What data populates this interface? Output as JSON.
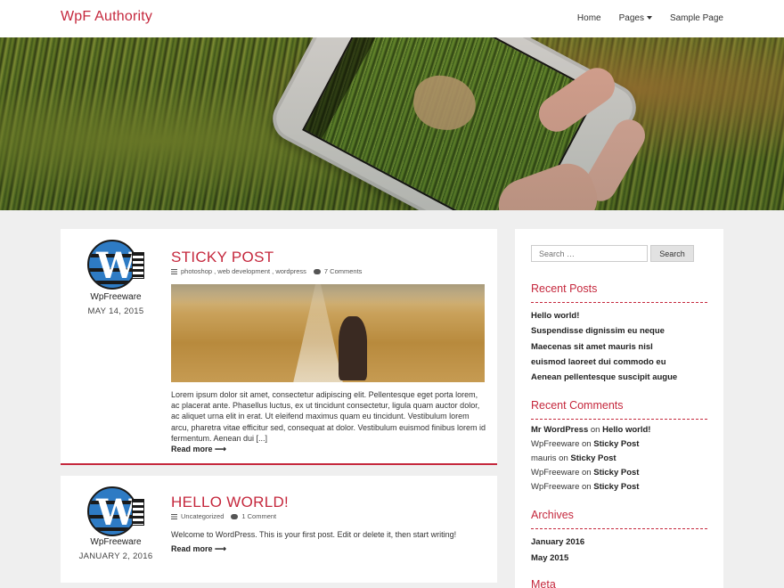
{
  "site": {
    "title": "WpF Authority"
  },
  "nav": {
    "home": "Home",
    "pages": "Pages",
    "sample": "Sample Page"
  },
  "posts": [
    {
      "author": "WpFreeware",
      "date": "MAY 14, 2015",
      "title": "STICKY POST",
      "categories": "photoshop , web development , wordpress",
      "comments": "7 Comments",
      "excerpt": "Lorem ipsum dolor sit amet, consectetur adipiscing elit. Pellentesque eget porta lorem, ac placerat ante. Phasellus luctus, ex ut tincidunt consectetur, ligula quam auctor dolor, ac aliquet urna elit in erat. Ut eleifend maximus quam eu tincidunt. Vestibulum lorem arcu, pharetra vitae efficitur sed, consequat at dolor. Vestibulum euismod finibus lorem id fermentum. Aenean dui [...]",
      "readmore": "Read more ⟶"
    },
    {
      "author": "WpFreeware",
      "date": "JANUARY 2, 2016",
      "title": "HELLO WORLD!",
      "categories": "Uncategorized",
      "comments": "1 Comment",
      "excerpt": "Welcome to WordPress. This is your first post. Edit or delete it, then start writing!",
      "readmore": "Read more ⟶"
    }
  ],
  "sidebar": {
    "search": {
      "placeholder": "Search …",
      "button": "Search"
    },
    "recent_posts": {
      "title": "Recent Posts",
      "items": [
        "Hello world!",
        "Suspendisse dignissim eu neque",
        "Maecenas sit amet mauris nisl",
        "euismod laoreet dui commodo eu",
        "Aenean pellentesque suscipit augue"
      ]
    },
    "recent_comments": {
      "title": "Recent Comments",
      "on": "on",
      "items": [
        {
          "author": "Mr WordPress",
          "post": "Hello world!"
        },
        {
          "author": "WpFreeware",
          "post": "Sticky Post"
        },
        {
          "author": "mauris",
          "post": "Sticky Post"
        },
        {
          "author": "WpFreeware",
          "post": "Sticky Post"
        },
        {
          "author": "WpFreeware",
          "post": "Sticky Post"
        }
      ]
    },
    "archives": {
      "title": "Archives",
      "items": [
        "January 2016",
        "May 2015"
      ]
    },
    "meta": {
      "title": "Meta"
    }
  },
  "colors": {
    "accent": "#c5283d",
    "background": "#efefef",
    "card": "#ffffff"
  }
}
